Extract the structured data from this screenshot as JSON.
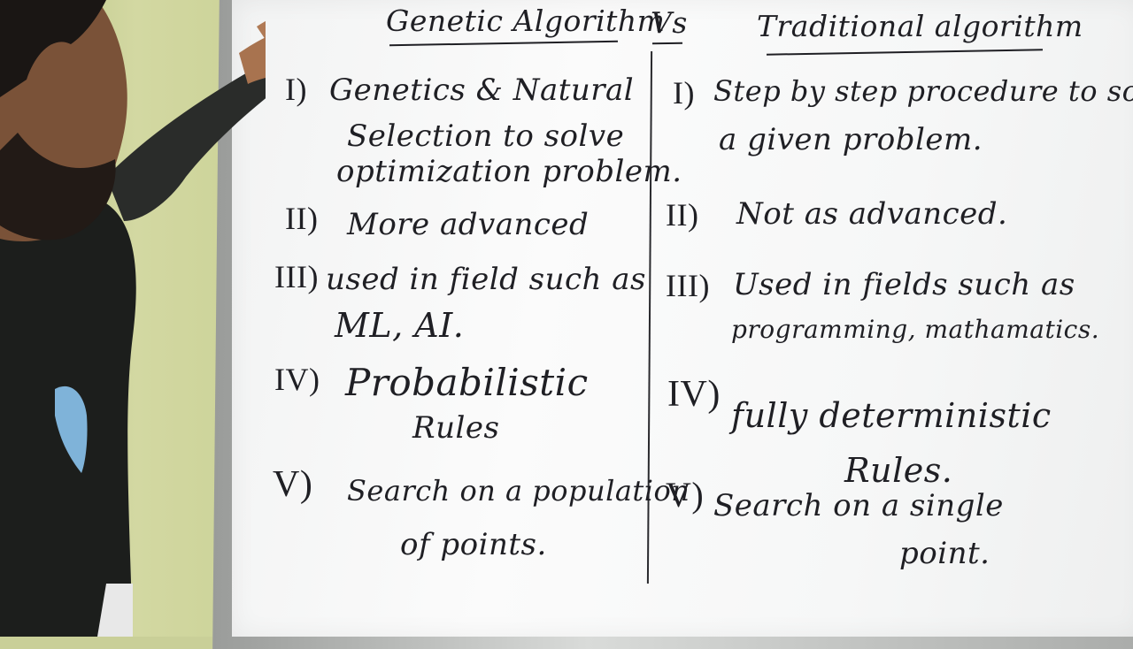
{
  "header": {
    "left_title": "Genetic Algorithm",
    "vs": "Vs",
    "right_title": "Traditional algorithm"
  },
  "left": [
    {
      "num": "I)",
      "lines": [
        "Genetics & Natural",
        "Selection to solve",
        "optimization problem."
      ]
    },
    {
      "num": "II)",
      "lines": [
        "More advanced"
      ]
    },
    {
      "num": "III)",
      "lines": [
        "used in field such as",
        "ML, AI."
      ]
    },
    {
      "num": "IV)",
      "lines": [
        "Probabilistic",
        "Rules"
      ]
    },
    {
      "num": "V)",
      "lines": [
        "Search on a population",
        "of points."
      ]
    }
  ],
  "right": [
    {
      "num": "I)",
      "lines": [
        "Step by step procedure to solve",
        "a given problem."
      ]
    },
    {
      "num": "II)",
      "lines": [
        "Not as advanced."
      ]
    },
    {
      "num": "III)",
      "lines": [
        "Used in fields such as",
        "programming, mathamatics."
      ]
    },
    {
      "num": "IV)",
      "lines": [
        "fully deterministic",
        "Rules."
      ]
    },
    {
      "num": "V)",
      "lines": [
        "Search on a single",
        "point."
      ]
    }
  ],
  "colors": {
    "wall": "#c9cf98",
    "board": "#f6f7f7",
    "marker": "#1f1f24",
    "shirt": "#1c1e1c"
  }
}
